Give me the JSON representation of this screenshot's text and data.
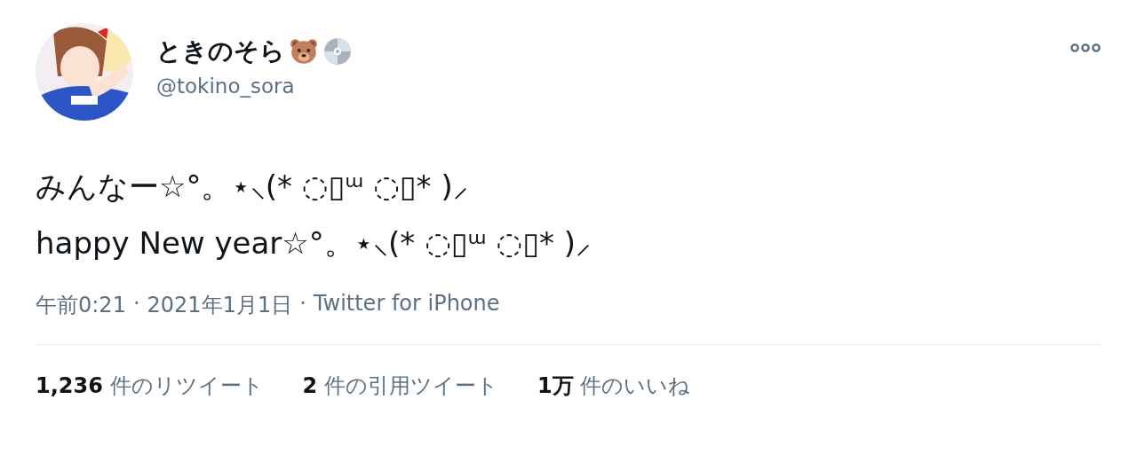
{
  "author": {
    "name": "ときのそら",
    "handle": "@tokino_sora"
  },
  "tweet": {
    "lines": [
      "みんなー☆°。⋆⸜(* ◌▯ᵚ ◌▯* )⸝",
      "happy New year☆°。⋆⸜(* ◌▯ᵚ ◌▯* )⸝"
    ]
  },
  "meta": {
    "time": "午前0:21",
    "separator_1": "·",
    "date": "2021年1月1日",
    "separator_2": "·",
    "source": "Twitter for iPhone"
  },
  "stats": [
    {
      "count": "1,236",
      "label": "件のリツイート"
    },
    {
      "count": "2",
      "label": "件の引用ツイート"
    },
    {
      "count": "1万",
      "label": "件のいいね"
    }
  ]
}
